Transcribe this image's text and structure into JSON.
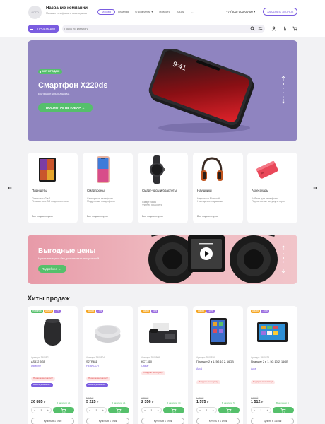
{
  "header": {
    "logo": "ЛОГО",
    "company_name": "Название компании",
    "company_desc": "Магазин телефонов и аксессуаров",
    "city": "Москва",
    "nav": [
      "Главная",
      "О компании ▾",
      "Новости",
      "Акции",
      "..."
    ],
    "phone": "+7 (000) 000-00-00 ▾",
    "callback": "ЗАКАЗАТЬ ЗВОНОК"
  },
  "toolbar": {
    "products": "ПРОДУКЦИЯ",
    "search_placeholder": "Поиск по каталогу"
  },
  "banner1": {
    "badge": "ХИТ ПРОДАЖ",
    "title": "Смартфон X220ds",
    "subtitle": "Большая распродажа",
    "button": "ПОСМОТРЕТЬ ТОВАР  →",
    "screen_time": "9:41"
  },
  "categories": [
    {
      "title": "Планшеты",
      "sub": "Планшеты 2 в 1\nПланшеты с 3G подключением",
      "all": "Все подкатегории",
      "img": "tablet"
    },
    {
      "title": "Смартфоны",
      "sub": "Сенсорные телефоны\nМодульные смартфоны",
      "all": "Все подкатегории",
      "img": "phone"
    },
    {
      "title": "Смарт-часы и браслеты",
      "sub": "Смарт-часы\nФитнес браслеты",
      "all": "Все подкатегории",
      "img": "watch"
    },
    {
      "title": "Наушники",
      "sub": "Наушники Bluetooth\nНакладные наушники",
      "all": "Все подкатегории",
      "img": "headphones"
    },
    {
      "title": "Аксессуары",
      "sub": "Кабели для телефона\nПортативные аккумуляторы",
      "all": "",
      "img": "powerbank"
    }
  ],
  "banner2": {
    "title": "Выгодные цены",
    "subtitle": "Нужные покупки без дополнительных условий",
    "button": "Подробнее  →"
  },
  "hits_title": "Хиты продаж",
  "products": [
    {
      "tags": [
        [
          "new",
          "Новинка"
        ],
        [
          "hit",
          "Акция"
        ],
        [
          "disc",
          "-7%"
        ]
      ],
      "art": "Артикул: 3500501",
      "name": "AS512 5GB",
      "brand": "Digasine",
      "gift": "Подарок за покупку!",
      "cheaper": "Нашли дешевле?",
      "old_price": "",
      "price": "26 885",
      "unit": "₽",
      "stock": "В наличии: 21",
      "img": "speaker"
    },
    {
      "tags": [
        [
          "hit",
          "Акция"
        ],
        [
          "disc",
          "-7%"
        ]
      ],
      "art": "Артикул: 3500504",
      "name": "S2TR611",
      "brand": "HEBKOCH",
      "gift": "Подарок за покупку!",
      "cheaper": "Нашли дешевле?",
      "old_price": "5 625 ₽",
      "price": "5 225",
      "unit": "₽",
      "stock": "В наличии: 21",
      "img": "homepod"
    },
    {
      "tags": [
        [
          "hit",
          "Акция"
        ],
        [
          "disc",
          "-5%"
        ]
      ],
      "art": "Артикул: 3500508",
      "name": "KCT-310",
      "brand": "Castar",
      "gift": "Подарок за покупку!",
      "cheaper": "",
      "old_price": "2 490 ₽",
      "price": "2 356",
      "unit": "₽",
      "stock": "В наличии: 14",
      "img": "fax"
    },
    {
      "tags": [
        [
          "hit",
          "Акция"
        ],
        [
          "disc",
          "-10%"
        ]
      ],
      "art": "Артикул: 3500576",
      "name": "Планшет 2 в 1, 5G 10 2, 16GB",
      "brand": "Acral",
      "gift": "Подарок за покупку!",
      "cheaper": "",
      "old_price": "1 750 ₽",
      "price": "1 575",
      "unit": "₽",
      "stock": "В наличии: 5",
      "img": "tablet2"
    },
    {
      "tags": [
        [
          "hit",
          "Акция"
        ],
        [
          "disc",
          "-10%"
        ]
      ],
      "art": "Артикул: 3500578",
      "name": "Планшет 2 в 1, 5G 10 2, 16GB",
      "brand": "Acral",
      "gift": "Подарок за покупку!",
      "cheaper": "",
      "old_price": "1 680 ₽",
      "price": "1 512",
      "unit": "₽",
      "stock": "В наличии: 5",
      "img": "tablet3"
    }
  ],
  "product_ui": {
    "qty": "1",
    "oneclick": "Купить в 1 клик"
  },
  "colors": {
    "accent": "#7a5ce0",
    "green": "#55c06b",
    "banner1": "#8f84c0",
    "banner2": "#eeb6bd"
  }
}
